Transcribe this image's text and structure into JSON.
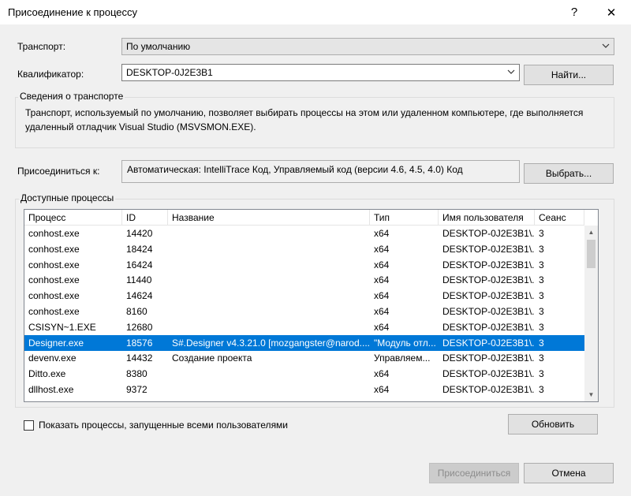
{
  "window": {
    "title": "Присоединение к процессу",
    "help_glyph": "?",
    "close_glyph": "✕"
  },
  "transport": {
    "label": "Транспорт:",
    "value": "По умолчанию"
  },
  "qualifier": {
    "label": "Квалификатор:",
    "value": "DESKTOP-0J2E3B1",
    "find_button": "Найти..."
  },
  "transport_info": {
    "label": "Сведения о транспорте",
    "text": "Транспорт, используемый по умолчанию, позволяет выбирать процессы на этом или удаленном компьютере, где выполняется удаленный отладчик Visual Studio (MSVSMON.EXE)."
  },
  "attach_to": {
    "label": "Присоединиться к:",
    "value": "Автоматическая: IntelliTrace Код, Управляемый код (версии 4.6, 4.5, 4.0) Код",
    "select_button": "Выбрать..."
  },
  "processes": {
    "label": "Доступные процессы",
    "columns": [
      "Процесс",
      "ID",
      "Название",
      "Тип",
      "Имя пользователя",
      "Сеанс"
    ],
    "rows": [
      {
        "process": "conhost.exe",
        "id": "14420",
        "title": "",
        "type": "x64",
        "user": "DESKTOP-0J2E3B1\\...",
        "session": "3"
      },
      {
        "process": "conhost.exe",
        "id": "18424",
        "title": "",
        "type": "x64",
        "user": "DESKTOP-0J2E3B1\\...",
        "session": "3"
      },
      {
        "process": "conhost.exe",
        "id": "16424",
        "title": "",
        "type": "x64",
        "user": "DESKTOP-0J2E3B1\\...",
        "session": "3"
      },
      {
        "process": "conhost.exe",
        "id": "11440",
        "title": "",
        "type": "x64",
        "user": "DESKTOP-0J2E3B1\\...",
        "session": "3"
      },
      {
        "process": "conhost.exe",
        "id": "14624",
        "title": "",
        "type": "x64",
        "user": "DESKTOP-0J2E3B1\\...",
        "session": "3"
      },
      {
        "process": "conhost.exe",
        "id": "8160",
        "title": "",
        "type": "x64",
        "user": "DESKTOP-0J2E3B1\\...",
        "session": "3"
      },
      {
        "process": "CSISYN~1.EXE",
        "id": "12680",
        "title": "",
        "type": "x64",
        "user": "DESKTOP-0J2E3B1\\...",
        "session": "3"
      },
      {
        "process": "Designer.exe",
        "id": "18576",
        "title": "S#.Designer v4.3.21.0 [mozgangster@narod....",
        "type": "\"Модуль отл...",
        "user": "DESKTOP-0J2E3B1\\...",
        "session": "3",
        "selected": true
      },
      {
        "process": "devenv.exe",
        "id": "14432",
        "title": "Создание проекта",
        "type": "Управляем...",
        "user": "DESKTOP-0J2E3B1\\...",
        "session": "3"
      },
      {
        "process": "Ditto.exe",
        "id": "8380",
        "title": "",
        "type": "x64",
        "user": "DESKTOP-0J2E3B1\\...",
        "session": "3"
      },
      {
        "process": "dllhost.exe",
        "id": "9372",
        "title": "",
        "type": "x64",
        "user": "DESKTOP-0J2E3B1\\...",
        "session": "3"
      }
    ]
  },
  "show_all": {
    "label": "Показать процессы, запущенные всеми пользователями",
    "checked": false
  },
  "refresh_button": "Обновить",
  "attach_button": "Присоединиться",
  "cancel_button": "Отмена"
}
